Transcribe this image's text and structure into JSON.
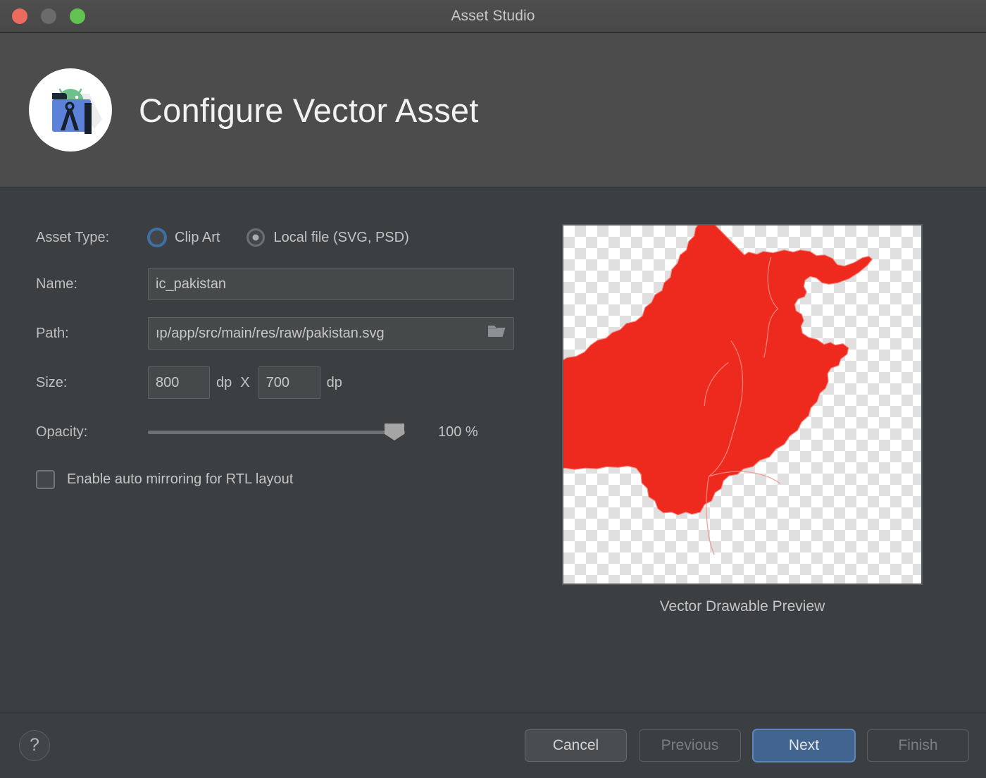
{
  "window": {
    "title": "Asset Studio",
    "traffic_lights": [
      "close-red",
      "minimize-gray",
      "zoom-green"
    ]
  },
  "header": {
    "title": "Configure Vector Asset",
    "icon": "android-asset-studio-icon"
  },
  "form": {
    "asset_type": {
      "label": "Asset Type:",
      "options": [
        {
          "label": "Clip Art",
          "selected": false,
          "focused": true
        },
        {
          "label": "Local file (SVG, PSD)",
          "selected": true,
          "focused": false
        }
      ]
    },
    "name": {
      "label": "Name:",
      "value": "ic_pakistan"
    },
    "path": {
      "label": "Path:",
      "value": "ıp/app/src/main/res/raw/pakistan.svg",
      "browse_icon": "folder-open-icon"
    },
    "size": {
      "label": "Size:",
      "width_value": "800",
      "width_unit": "dp",
      "separator": "X",
      "height_value": "700",
      "height_unit": "dp"
    },
    "opacity": {
      "label": "Opacity:",
      "value": "100 %",
      "percent": 100
    },
    "mirroring": {
      "label": "Enable auto mirroring for RTL layout",
      "checked": false
    }
  },
  "preview": {
    "caption": "Vector Drawable Preview",
    "shape_name": "pakistan-map",
    "shape_color": "#ee2a1e",
    "background": "transparency-checkerboard"
  },
  "footer": {
    "help_label": "?",
    "buttons": [
      {
        "label": "Cancel",
        "style": "cancel",
        "enabled": true
      },
      {
        "label": "Previous",
        "style": "disabled",
        "enabled": false
      },
      {
        "label": "Next",
        "style": "primary",
        "enabled": true
      },
      {
        "label": "Finish",
        "style": "disabled",
        "enabled": false
      }
    ]
  },
  "colors": {
    "header_bg": "#4c4c4c",
    "body_bg": "#3c3f41",
    "accent_blue": "#41658f",
    "focus_blue": "#5b87bd",
    "map_red": "#ee2a1e",
    "text_primary": "#c4c4c4"
  }
}
